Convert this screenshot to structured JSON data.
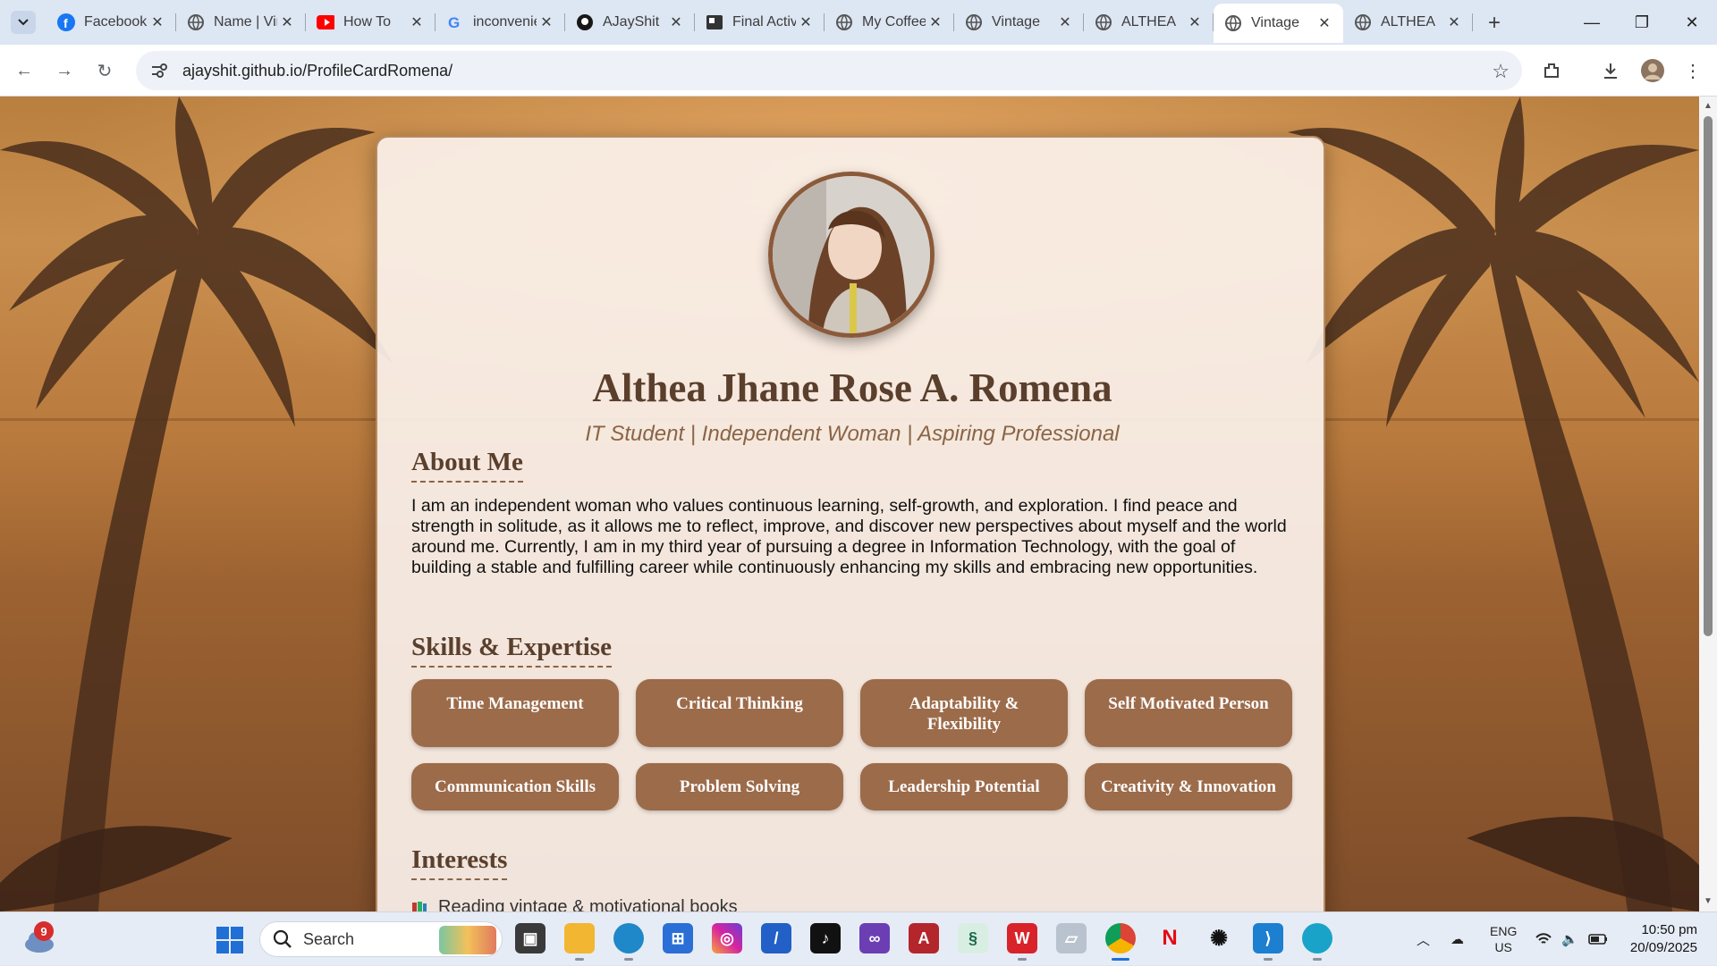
{
  "browser": {
    "tabs": [
      {
        "title": "Facebook",
        "icon": "facebook-icon",
        "active": false
      },
      {
        "title": "Name | Vintage",
        "icon": "globe-icon",
        "active": false
      },
      {
        "title": "How To",
        "icon": "youtube-icon",
        "active": false
      },
      {
        "title": "inconvenience",
        "icon": "google-icon",
        "active": false
      },
      {
        "title": "AJayShit",
        "icon": "github-icon",
        "active": false
      },
      {
        "title": "Final Activity",
        "icon": "doc-icon",
        "active": false
      },
      {
        "title": "My Coffee",
        "icon": "globe-icon",
        "active": false
      },
      {
        "title": "Vintage",
        "icon": "globe-icon",
        "active": false
      },
      {
        "title": "ALTHEA",
        "icon": "globe-icon",
        "active": false
      },
      {
        "title": "Vintage",
        "icon": "globe-icon",
        "active": true
      },
      {
        "title": "ALTHEA",
        "icon": "globe-icon",
        "active": false
      }
    ],
    "url": "ajayshit.github.io/ProfileCardRomena/"
  },
  "profile": {
    "name": "Althea Jhane Rose A. Romena",
    "tagline": "IT Student | Independent Woman | Aspiring Professional",
    "about_title": "About Me",
    "about_text": "I am an independent woman who values continuous learning, self-growth, and exploration. I find peace and strength in solitude, as it allows me to reflect, improve, and discover new perspectives about myself and the world around me. Currently, I am in my third year of pursuing a degree in Information Technology, with the goal of building a stable and fulfilling career while continuously enhancing my skills and embracing new opportunities.",
    "skills_title": "Skills & Expertise",
    "skills": [
      "Time Management",
      "Critical Thinking",
      "Adaptability & Flexibility",
      "Self Motivated Person",
      "Communication Skills",
      "Problem Solving",
      "Leadership Potential",
      "Creativity & Innovation"
    ],
    "interests_title": "Interests",
    "interests": [
      "Reading vintage & motivational books"
    ]
  },
  "taskbar": {
    "weather_badge": "9",
    "search_label": "Search",
    "lang_line1": "ENG",
    "lang_line2": "US",
    "time": "10:50 pm",
    "date": "20/09/2025"
  },
  "colors": {
    "card_bg": "#faf0ea",
    "accent_brown": "#9c6b4a",
    "heading_brown": "#5a3f2c"
  }
}
